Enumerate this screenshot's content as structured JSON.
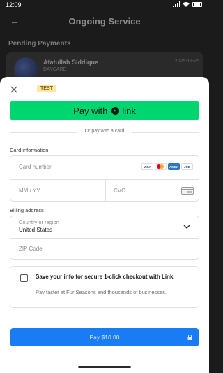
{
  "status_bar": {
    "time": "12:09"
  },
  "background": {
    "title": "Ongoing Service",
    "section": "Pending Payments",
    "card": {
      "name": "Afatullah Siddique",
      "subtitle": "DAYCARE",
      "date": "2025-11-26"
    }
  },
  "sheet": {
    "badge": "TEST",
    "link_button": {
      "prefix": "Pay with",
      "brand": "link"
    },
    "divider_text": "Or pay with a card",
    "card_info_label": "Card information",
    "card_number_placeholder": "Card number",
    "expiry_placeholder": "MM / YY",
    "cvc_placeholder": "CVC",
    "card_brands": [
      "VISA",
      "MC",
      "AMEX",
      "JCB"
    ],
    "billing_label": "Billing address",
    "country_label": "Country or region",
    "country_value": "United States",
    "zip_placeholder": "ZIP Code",
    "save_info": {
      "title": "Save your info for secure 1-click checkout with Link",
      "subtitle": "Pay faster at Fur Seasons and thousands of businesses."
    },
    "pay_button": "Pay $10.00"
  },
  "colors": {
    "link_green": "#00d66f",
    "pay_blue": "#1a7cf5",
    "badge_bg": "#fde7a6"
  }
}
